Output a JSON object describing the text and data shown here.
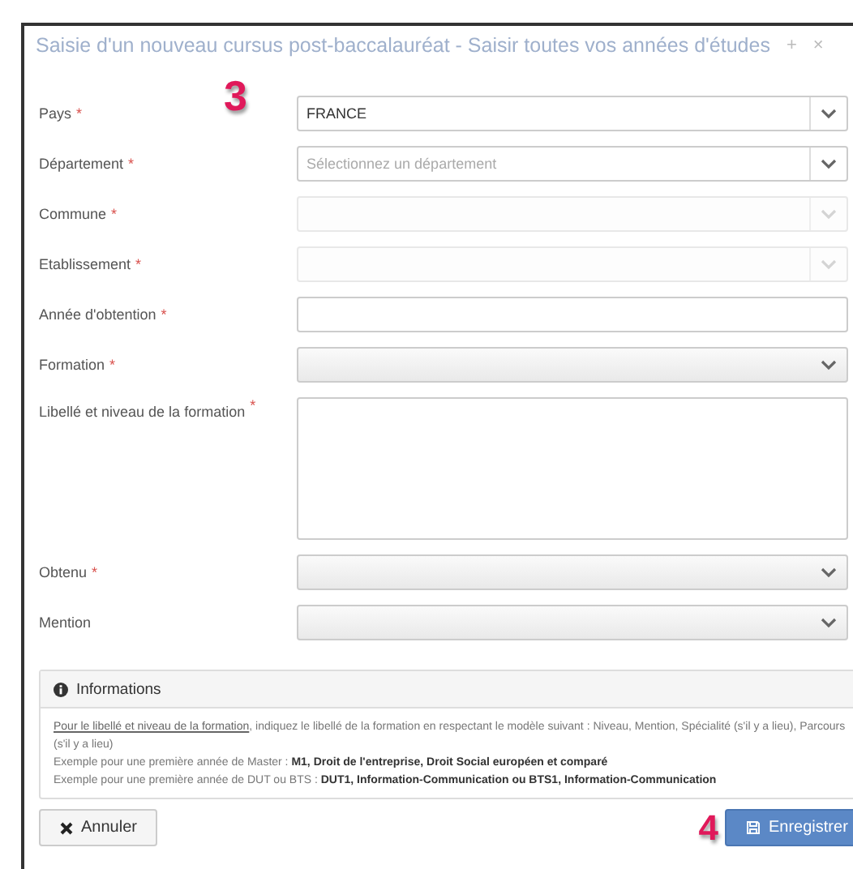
{
  "dialog": {
    "title": "Saisie d'un nouveau cursus post-baccalauréat - Saisir toutes vos années d'études",
    "controls": [
      "+",
      "×"
    ]
  },
  "form_step": "3",
  "fields": [
    {
      "label": "Pays",
      "marker": "*",
      "kind": "combobox",
      "disabled": false,
      "value": "FRANCE"
    },
    {
      "label": "Département",
      "marker": "*",
      "kind": "combobox",
      "disabled": false,
      "placeholder": "Sélectionnez un département"
    },
    {
      "label": "Commune",
      "marker": "*",
      "kind": "combobox",
      "disabled": true
    },
    {
      "label": "Etablissement",
      "marker": "*",
      "kind": "combobox",
      "disabled": true
    },
    {
      "label": "Année d'obtention",
      "marker": "*",
      "kind": "text"
    },
    {
      "label": "Formation",
      "marker": "*",
      "kind": "select"
    },
    {
      "label": "Libellé et niveau de la formation",
      "marker": "*",
      "kind": "textarea"
    },
    {
      "label": "Obtenu",
      "marker": "*",
      "kind": "select"
    },
    {
      "label": "Mention",
      "kind": "select"
    }
  ],
  "info": {
    "title": "Informations",
    "link": "Pour le libellé et niveau de la formation",
    "text": ", indiquez le libellé de la formation en respectant le modèle suivant : Niveau, Mention, Spécialité (s'il y a lieu), Parcours (s'il y a lieu)",
    "examples": [
      "Exemple pour une première année de Master : **M1, Droit de l'entreprise, Droit Social européen et comparé**",
      "Exemple pour une première année de DUT ou BTS : **DUT1, Information-Communication ou BTS1, Information-Communication**"
    ]
  },
  "footer_step": "4",
  "buttons": [
    {
      "label": "Annuler",
      "kind": "cancel"
    },
    {
      "label": "Enregistrer",
      "kind": "save"
    }
  ]
}
